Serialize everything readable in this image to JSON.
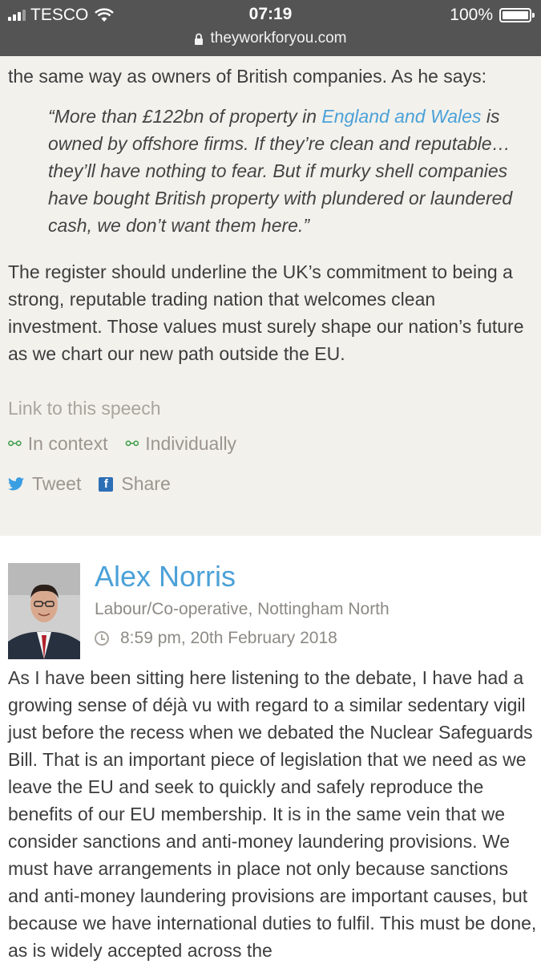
{
  "status": {
    "carrier": "TESCO",
    "time": "07:19",
    "battery": "100%",
    "battery_level": 1.0,
    "url": "theyworkforyou.com"
  },
  "speech1": {
    "intro": "the same way as owners of British companies. As he says:",
    "quote_before": "“More than £122bn of property in ",
    "quote_link": "England and Wales",
    "quote_after": " is owned by offshore firms. If they’re clean and reputable… they’ll have nothing to fear. But if murky shell companies have bought British property with plundered or laundered cash, we don’t want them here.”",
    "para2": "The register should underline the UK’s commitment to being a strong, reputable trading nation that welcomes clean investment. Those values must surely shape our nation’s future as we chart our new path outside the EU.",
    "link_label": "Link to this speech",
    "in_context": "In context",
    "individually": "Individually",
    "tweet": "Tweet",
    "share": "Share"
  },
  "speech2": {
    "name": "Alex Norris",
    "party": "Labour/Co-operative, Nottingham North",
    "time": "8:59 pm, 20th February 2018",
    "text": "As I have been sitting here listening to the debate, I have had a growing sense of déjà vu with regard to a similar sedentary vigil just before the recess when we debated the Nuclear Safeguards Bill. That is an important piece of legislation that we need as we leave the EU and seek to quickly and safely reproduce the benefits of our EU membership. It is in the same vein that we consider sanctions and anti-money laundering provisions. We must have arrangements in place not only because sanctions and anti-money laundering provisions are important causes, but because we have international duties to fulfil. This must be done, as is widely accepted across the"
  },
  "colors": {
    "statusbar": "#545454",
    "speech_bg": "#f3f1ec",
    "link": "#4ba1d8",
    "muted": "#a9a59e"
  }
}
